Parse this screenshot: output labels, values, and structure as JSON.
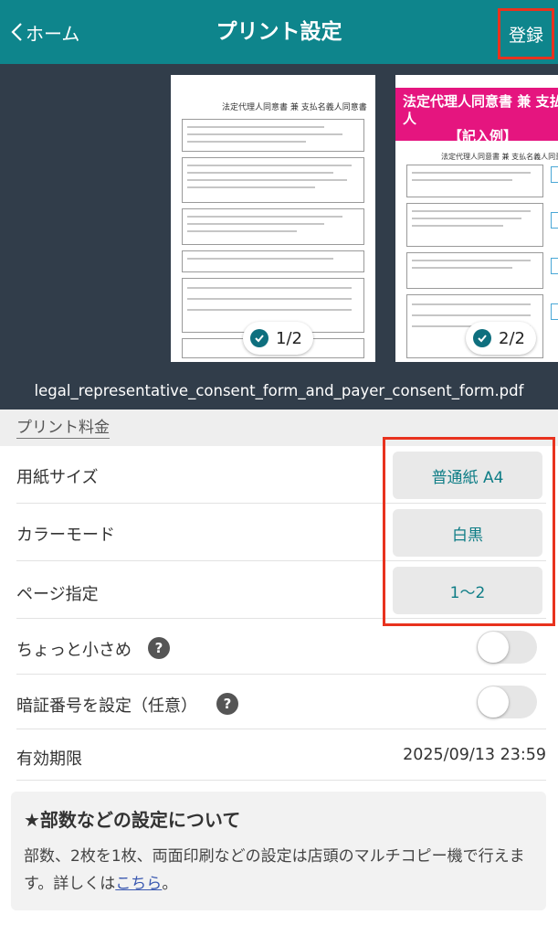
{
  "header": {
    "back_label": "ホーム",
    "title": "プリント設定",
    "register_label": "登録"
  },
  "preview": {
    "pages": [
      {
        "badge": "1/2",
        "heading": "法定代理人同意書 兼 支払名義人同意書"
      },
      {
        "badge": "2/2",
        "band_line1": "法定代理人同意書 兼 支払名義人",
        "band_line2": "【記入例】",
        "heading": "法定代理人同意書 兼 支払名義人同意書"
      }
    ],
    "filename": "legal_representative_consent_form_and_payer_consent_form.pdf"
  },
  "section": {
    "title": "プリント料金"
  },
  "settings": {
    "paper_size": {
      "label": "用紙サイズ",
      "value": "普通紙 A4"
    },
    "color_mode": {
      "label": "カラーモード",
      "value": "白黒"
    },
    "page_range": {
      "label": "ページ指定",
      "value": "1〜2"
    },
    "smaller": {
      "label": "ちょっと小さめ",
      "help": "?",
      "enabled": false
    },
    "pin": {
      "label": "暗証番号を設定（任意）",
      "help": "?",
      "enabled": false
    },
    "expiry": {
      "label": "有効期限",
      "value": "2025/09/13 23:59"
    }
  },
  "info": {
    "title": "★部数などの設定について",
    "text": "部数、2枚を1枚、両面印刷などの設定は店頭のマルチコピー機で行えます。詳しくは",
    "link": "こちら",
    "suffix": "。"
  },
  "colors": {
    "header_bg": "#0e858c",
    "accent": "#0e7d86",
    "highlight_frame": "#e8321e",
    "preview_bg": "#313d4a",
    "band": "#e5157f"
  }
}
